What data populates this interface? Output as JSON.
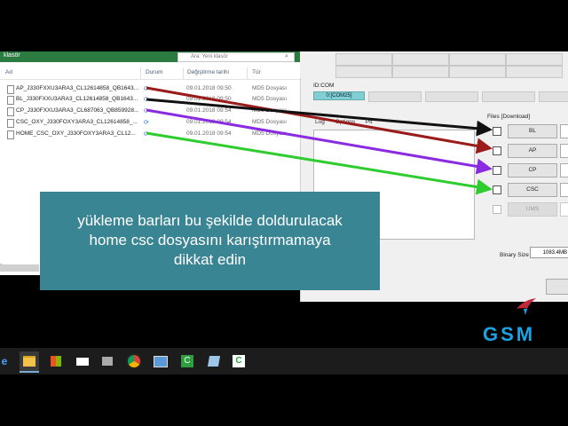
{
  "explorer": {
    "title": "klasör",
    "search_placeholder": "Ara: Yeni klasör",
    "columns": {
      "name": "Ad",
      "status": "Durum",
      "modified": "Değiştirme tarihi",
      "type": "Tür"
    },
    "files": [
      {
        "name": "AP_J330FXXU3ARA3_CL12614858_QB1643...",
        "status": "⟳",
        "modified": "09.01.2018 09:50",
        "type": "MD5 Dosyası"
      },
      {
        "name": "BL_J330FXXU3ARA3_CL12614858_QB1643...",
        "status": "⟳",
        "modified": "09.01.2018 09:50",
        "type": "MD5 Dosyası"
      },
      {
        "name": "CP_J330FXXU3ARA3_CL687063_QB859928...",
        "status": "⟳",
        "modified": "09.01.2018 09:54",
        "type": "MD5 Dosyası"
      },
      {
        "name": "CSC_OXY_J330FOXY3ARA3_CL12614858_...",
        "status": "⟳",
        "modified": "09.01.2018 09:54",
        "type": "MD5 Dosyası"
      },
      {
        "name": "HOME_CSC_OXY_J330FOXY3ARA3_CL12...",
        "status": "⟳",
        "modified": "09.01.2018 09:54",
        "type": "MD5 Dosyası"
      }
    ]
  },
  "odin": {
    "id_com_label": "ID:COM",
    "com_port": "0:[COM25]",
    "tabs": [
      "Log",
      "Options",
      "Pit"
    ],
    "files_label": "Files [Download]",
    "file_buttons": [
      "BL",
      "AP",
      "CP",
      "CSC",
      "UMS"
    ],
    "binary_size_label": "Binary Size",
    "binary_size_value": "1083.4MB"
  },
  "caption": {
    "line1": "yükleme barları bu şekilde doldurulacak",
    "line2": "home csc dosyasını karıştırmamaya",
    "line3": "dikkat  edin"
  },
  "logo": {
    "text": "GSM"
  },
  "arrow_colors": {
    "ap": "#9b1b1b",
    "bl": "#111111",
    "cp": "#8a2be2",
    "home_csc": "#2ecc2e"
  },
  "taskbar": {
    "icons": [
      "file-explorer-icon",
      "store-icon",
      "mail-icon",
      "media-icon",
      "chrome-icon",
      "computer-icon",
      "camtasia-icon",
      "notepad-icon",
      "camtasia-recorder-icon"
    ]
  }
}
